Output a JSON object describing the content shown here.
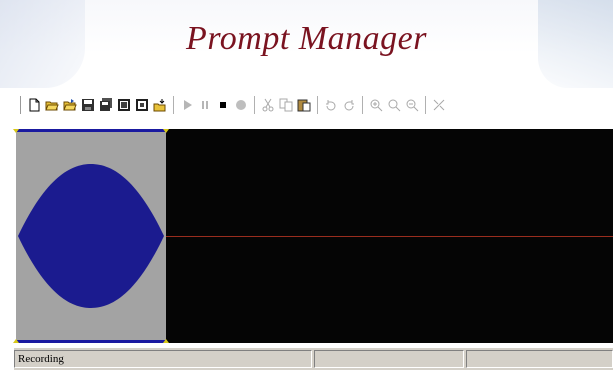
{
  "app": {
    "title": "Prompt Manager"
  },
  "toolbar": {
    "buttons": [
      {
        "icon": "new-file-icon"
      },
      {
        "icon": "open-folder-icon"
      },
      {
        "icon": "open-folder-alt-icon"
      },
      {
        "icon": "save-icon"
      },
      {
        "icon": "save-all-icon"
      },
      {
        "icon": "film-icon"
      },
      {
        "icon": "film-alt-icon"
      },
      {
        "icon": "import-icon"
      },
      {
        "icon": "play-icon"
      },
      {
        "icon": "pause-icon"
      },
      {
        "icon": "stop-icon"
      },
      {
        "icon": "record-icon"
      },
      {
        "icon": "cut-icon"
      },
      {
        "icon": "copy-icon"
      },
      {
        "icon": "paste-icon"
      },
      {
        "icon": "undo-icon"
      },
      {
        "icon": "redo-icon"
      },
      {
        "icon": "zoom-in-icon"
      },
      {
        "icon": "zoom-fit-icon"
      },
      {
        "icon": "zoom-out-icon"
      },
      {
        "icon": "trim-icon"
      }
    ]
  },
  "colors": {
    "title": "#7a1320",
    "wave": "#1b1b8f",
    "selection": "#a3a3a3",
    "background": "#050505",
    "center_line": "#9a2d1e"
  },
  "status": {
    "panel1": "Recording",
    "panel2": "",
    "panel3": ""
  }
}
